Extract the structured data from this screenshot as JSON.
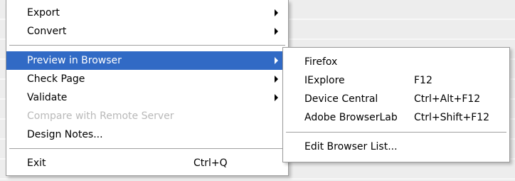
{
  "main_menu": {
    "items": [
      {
        "label": "Export",
        "submenu": true
      },
      {
        "label": "Convert",
        "submenu": true
      },
      {
        "label": "Preview in Browser",
        "submenu": true,
        "highlighted": true
      },
      {
        "label": "Check Page",
        "submenu": true
      },
      {
        "label": "Validate",
        "submenu": true
      },
      {
        "label": "Compare with Remote Server",
        "disabled": true
      },
      {
        "label": "Design Notes..."
      },
      {
        "label": "Exit",
        "shortcut": "Ctrl+Q"
      }
    ]
  },
  "submenu": {
    "items": [
      {
        "label": "Firefox",
        "shortcut": ""
      },
      {
        "label": "IExplore",
        "shortcut": "F12"
      },
      {
        "label": "Device Central",
        "shortcut": "Ctrl+Alt+F12"
      },
      {
        "label": "Adobe BrowserLab",
        "shortcut": "Ctrl+Shift+F12"
      },
      {
        "label": "Edit Browser List..."
      }
    ]
  },
  "colors": {
    "highlight": "#316ac5",
    "disabled_text": "#b9b9b9",
    "menu_bg": "#ffffff"
  },
  "icons": {
    "submenu_arrow": "chevron-right-icon"
  }
}
